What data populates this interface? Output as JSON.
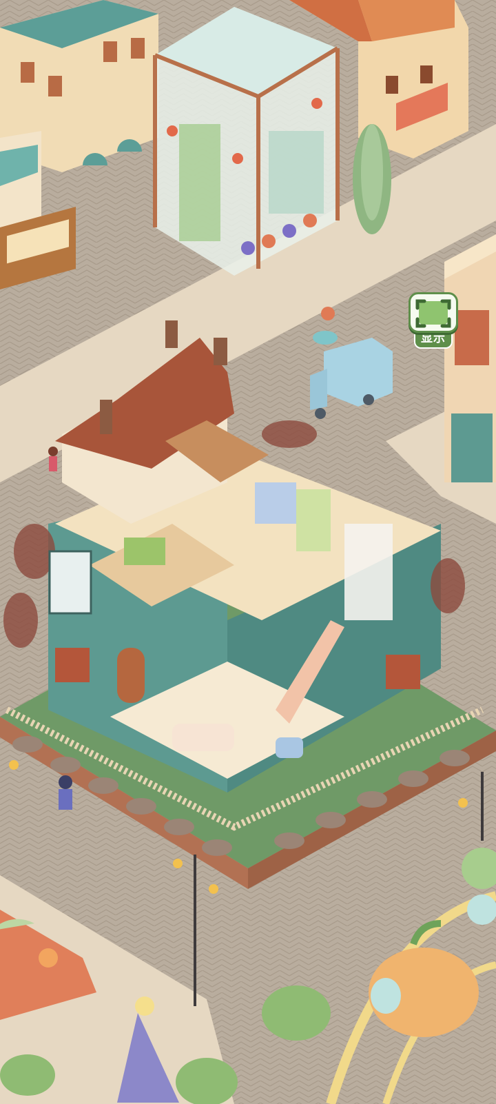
{
  "hud": {
    "display_button_label": "显示"
  },
  "icons": {
    "display_button": "frame-corners-icon"
  },
  "colors": {
    "road": "#b9ad9e",
    "house_wall": "#5d9a91",
    "roof": "#b85f3e",
    "hud_green": "#5e8f4a"
  }
}
